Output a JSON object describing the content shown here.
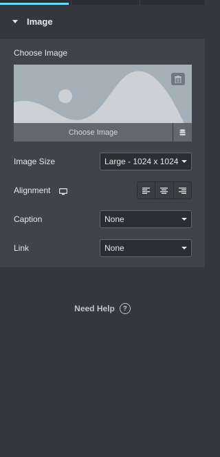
{
  "section": {
    "title": "Image"
  },
  "choose_image": {
    "label": "Choose Image",
    "button_label": "Choose Image"
  },
  "image_size": {
    "label": "Image Size",
    "value": "Large - 1024 x 1024"
  },
  "alignment": {
    "label": "Alignment"
  },
  "caption": {
    "label": "Caption",
    "value": "None"
  },
  "link": {
    "label": "Link",
    "value": "None"
  },
  "help": {
    "label": "Need Help",
    "glyph": "?"
  },
  "colors": {
    "accent": "#71d7f7",
    "panel": "#404349",
    "background": "#34373c"
  }
}
